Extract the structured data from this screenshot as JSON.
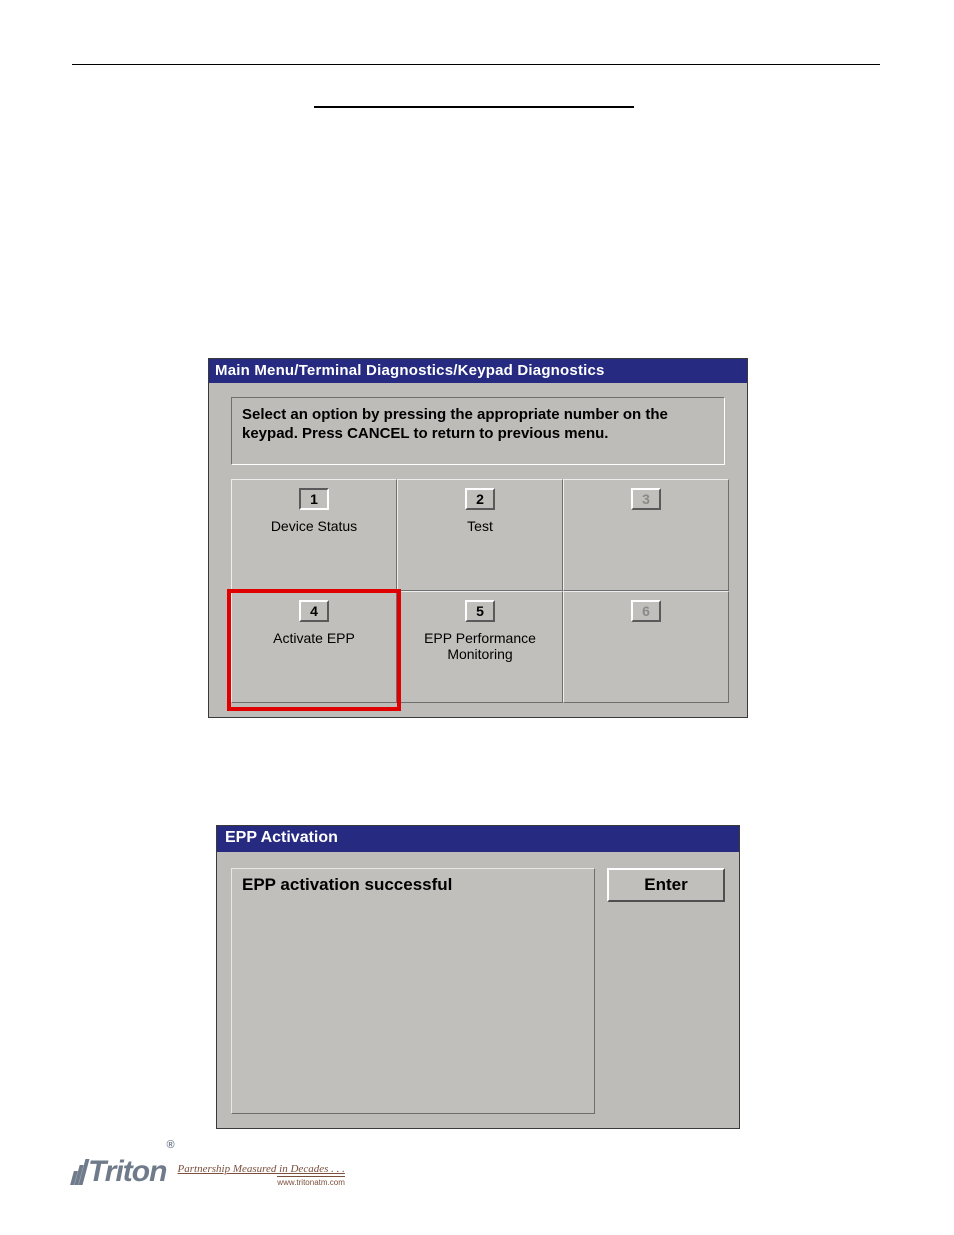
{
  "screenshot1": {
    "title": "Main Menu/Terminal Diagnostics/Keypad Diagnostics",
    "instructions": "Select an option by pressing the appropriate number on the keypad.  Press CANCEL to return to previous menu.",
    "cells": [
      {
        "num": "1",
        "label": "Device Status",
        "enabled": true,
        "selected": true
      },
      {
        "num": "2",
        "label": "Test",
        "enabled": true,
        "selected": false
      },
      {
        "num": "3",
        "label": "",
        "enabled": false,
        "selected": false
      },
      {
        "num": "4",
        "label": "Activate EPP",
        "enabled": true,
        "selected": false
      },
      {
        "num": "5",
        "label": "EPP Performance Monitoring",
        "enabled": true,
        "selected": false
      },
      {
        "num": "6",
        "label": "",
        "enabled": false,
        "selected": false
      }
    ]
  },
  "screenshot2": {
    "title": "EPP Activation",
    "message": "EPP activation successful",
    "enter_label": "Enter"
  },
  "footer": {
    "brand": "Triton",
    "tagline": "Partnership Measured in Decades . . .",
    "url": "www.tritonatm.com"
  }
}
